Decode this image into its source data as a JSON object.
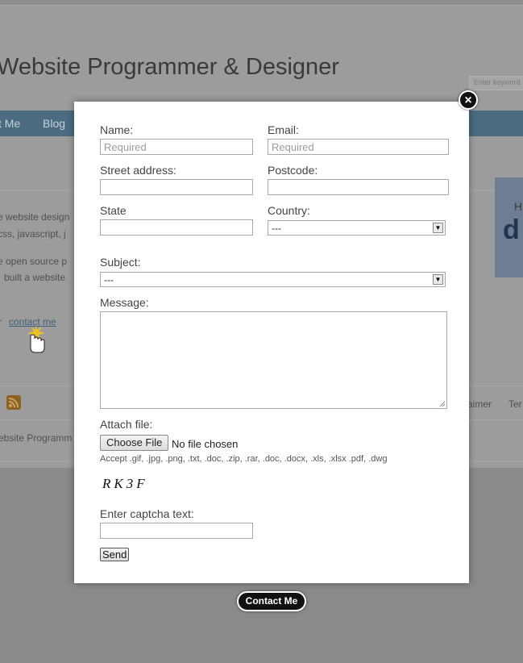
{
  "background": {
    "site_title": "Website Programmer & Designer",
    "search_placeholder": "Enter keyword",
    "nav_items": [
      "t Me",
      "Blog"
    ],
    "text_fragments": [
      "e website design",
      "css, javascript, j",
      "e open source p",
      "built a website",
      "r"
    ],
    "contact_link": "contact me",
    "footer_text": "ebsite Programm",
    "footer_links": [
      "aimer",
      "Ter"
    ],
    "banner_text": [
      "H",
      "d"
    ]
  },
  "form": {
    "name_label": "Name:",
    "name_placeholder": "Required",
    "email_label": "Email:",
    "email_placeholder": "Required",
    "street_label": "Street address:",
    "postcode_label": "Postcode:",
    "state_label": "State",
    "country_label": "Country:",
    "country_value": "---",
    "subject_label": "Subject:",
    "subject_value": "---",
    "message_label": "Message:",
    "attach_label": "Attach file:",
    "choose_file_label": "Choose File",
    "no_file_text": "No file chosen",
    "accept_text": "Accept .gif, .jpg, .png, .txt, .doc, .zip, .rar, .doc, .docx, .xls, .xlsx .pdf, .dwg",
    "captcha_image_text": "RK3F",
    "captcha_label": "Enter captcha text:",
    "send_label": "Send"
  },
  "close_symbol": "×",
  "contact_button_label": "Contact Me",
  "colors": {
    "overlay": "#8a8a8a",
    "navbar": "#4b6b81",
    "modal": "#ffffff",
    "button_dark": "#111111"
  }
}
